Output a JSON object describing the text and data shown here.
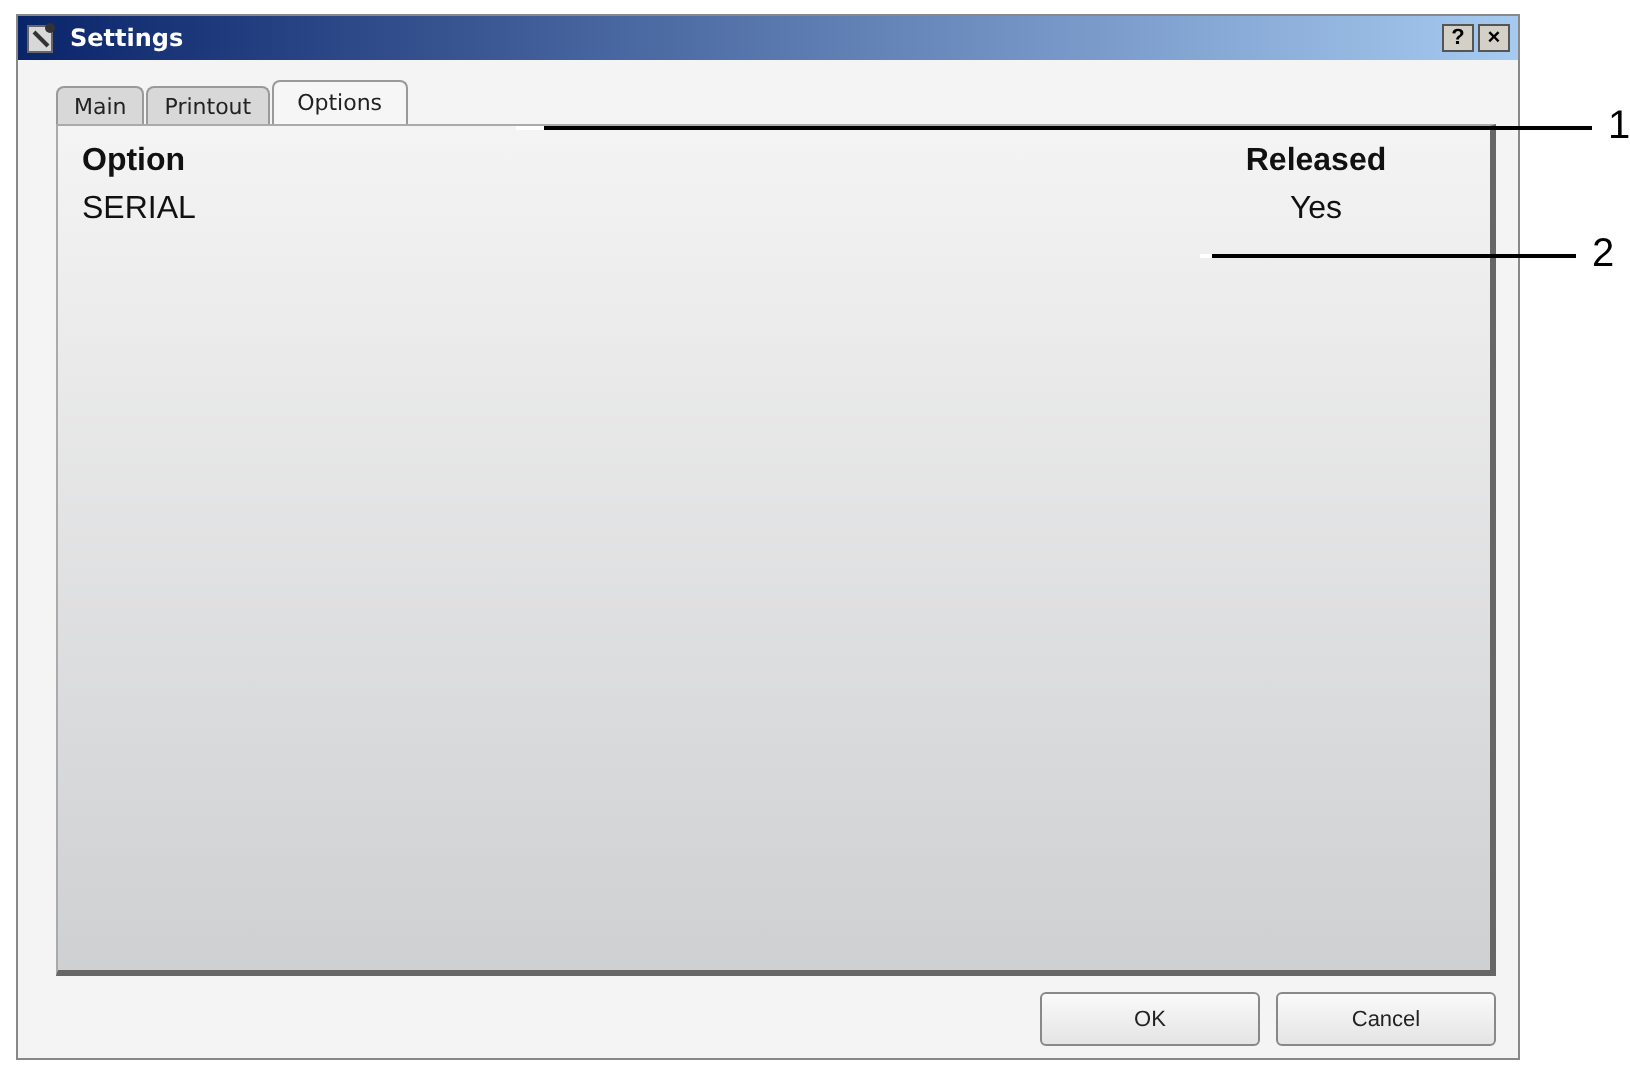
{
  "window": {
    "title": "Settings"
  },
  "title_buttons": [
    "?",
    "×"
  ],
  "tabs": [
    {
      "label": "Main",
      "selected": false
    },
    {
      "label": "Printout",
      "selected": false
    },
    {
      "label": "Options",
      "selected": true
    }
  ],
  "table": {
    "columns": [
      "Option",
      "Released"
    ],
    "rows": [
      [
        "SERIAL",
        "Yes"
      ]
    ]
  },
  "buttons": [
    "OK",
    "Cancel"
  ],
  "callouts": [
    "1",
    "2"
  ]
}
